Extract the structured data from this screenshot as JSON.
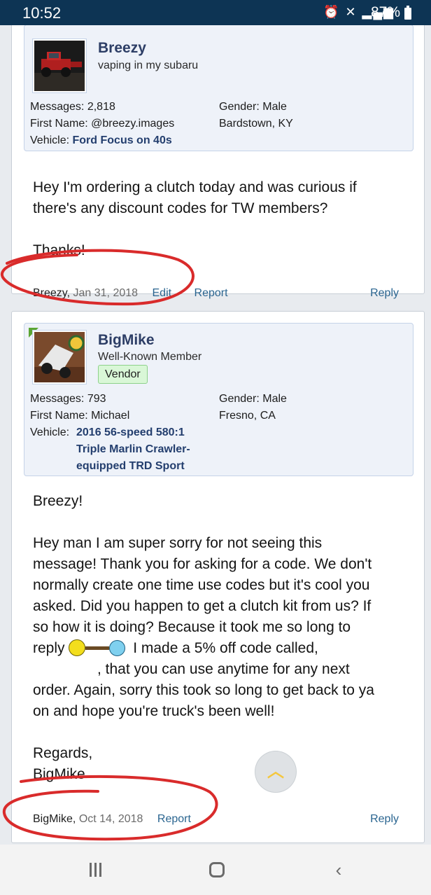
{
  "status_bar": {
    "time": "10:52",
    "battery": "87%"
  },
  "posts": [
    {
      "username": "Breezy",
      "user_title": "vaping in my subaru",
      "fields": {
        "messages_label": "Messages:",
        "messages": "2,818",
        "first_name_label": "First Name:",
        "first_name": "@breezy.images",
        "vehicle_label": "Vehicle:",
        "vehicle": "Ford Focus on 40s",
        "gender_label": "Gender:",
        "gender": "Male",
        "location": "Bardstown, KY"
      },
      "message_lines": [
        "Hey I'm ordering a clutch today and was curious if",
        "there's any discount codes for TW members?",
        "Thanks!"
      ],
      "footer": {
        "author": "Breezy,",
        "date": "Jan 31, 2018",
        "edit": "Edit",
        "report": "Report",
        "reply": "Reply"
      }
    },
    {
      "username": "BigMike",
      "user_title": "Well-Known Member",
      "badge": "Vendor",
      "fields": {
        "messages_label": "Messages:",
        "messages": "793",
        "first_name_label": "First Name:",
        "first_name": "Michael",
        "vehicle_label": "Vehicle:",
        "vehicle_lines": [
          "2016 56-speed 580:1",
          "Triple Marlin Crawler-",
          "equipped TRD Sport"
        ],
        "gender_label": "Gender:",
        "gender": "Male",
        "location": "Fresno, CA"
      },
      "message": {
        "greeting": "Breezy!",
        "lines": [
          "Hey man I am super sorry for not seeing this",
          "message! Thank you for asking for a code. We don't",
          "normally create one time use codes but it's cool you",
          "asked. Did you happen to get a clutch kit from us? If",
          "so how it is doing? Because it took me so long to"
        ],
        "reply_word": "reply",
        "after_emoji": "I made a 5% off code called,",
        "line_after_code": ", that you can use anytime for any next",
        "lines_end": [
          "order. Again, sorry this took so long to get back to ya",
          "on and hope you're truck's been well!"
        ],
        "closing": "Regards,",
        "signature": "BigMike"
      },
      "footer": {
        "author": "BigMike,",
        "date": "Oct 14, 2018",
        "report": "Report",
        "reply": "Reply"
      }
    }
  ],
  "colors": {
    "status_bar": "#0d3454",
    "link": "#2a6590",
    "username": "#2d3e66",
    "annotation": "#d92b2b"
  },
  "icons": {
    "scroll_top": "chevron-up-icon",
    "nav": [
      "recents-icon",
      "home-icon",
      "back-icon"
    ]
  }
}
